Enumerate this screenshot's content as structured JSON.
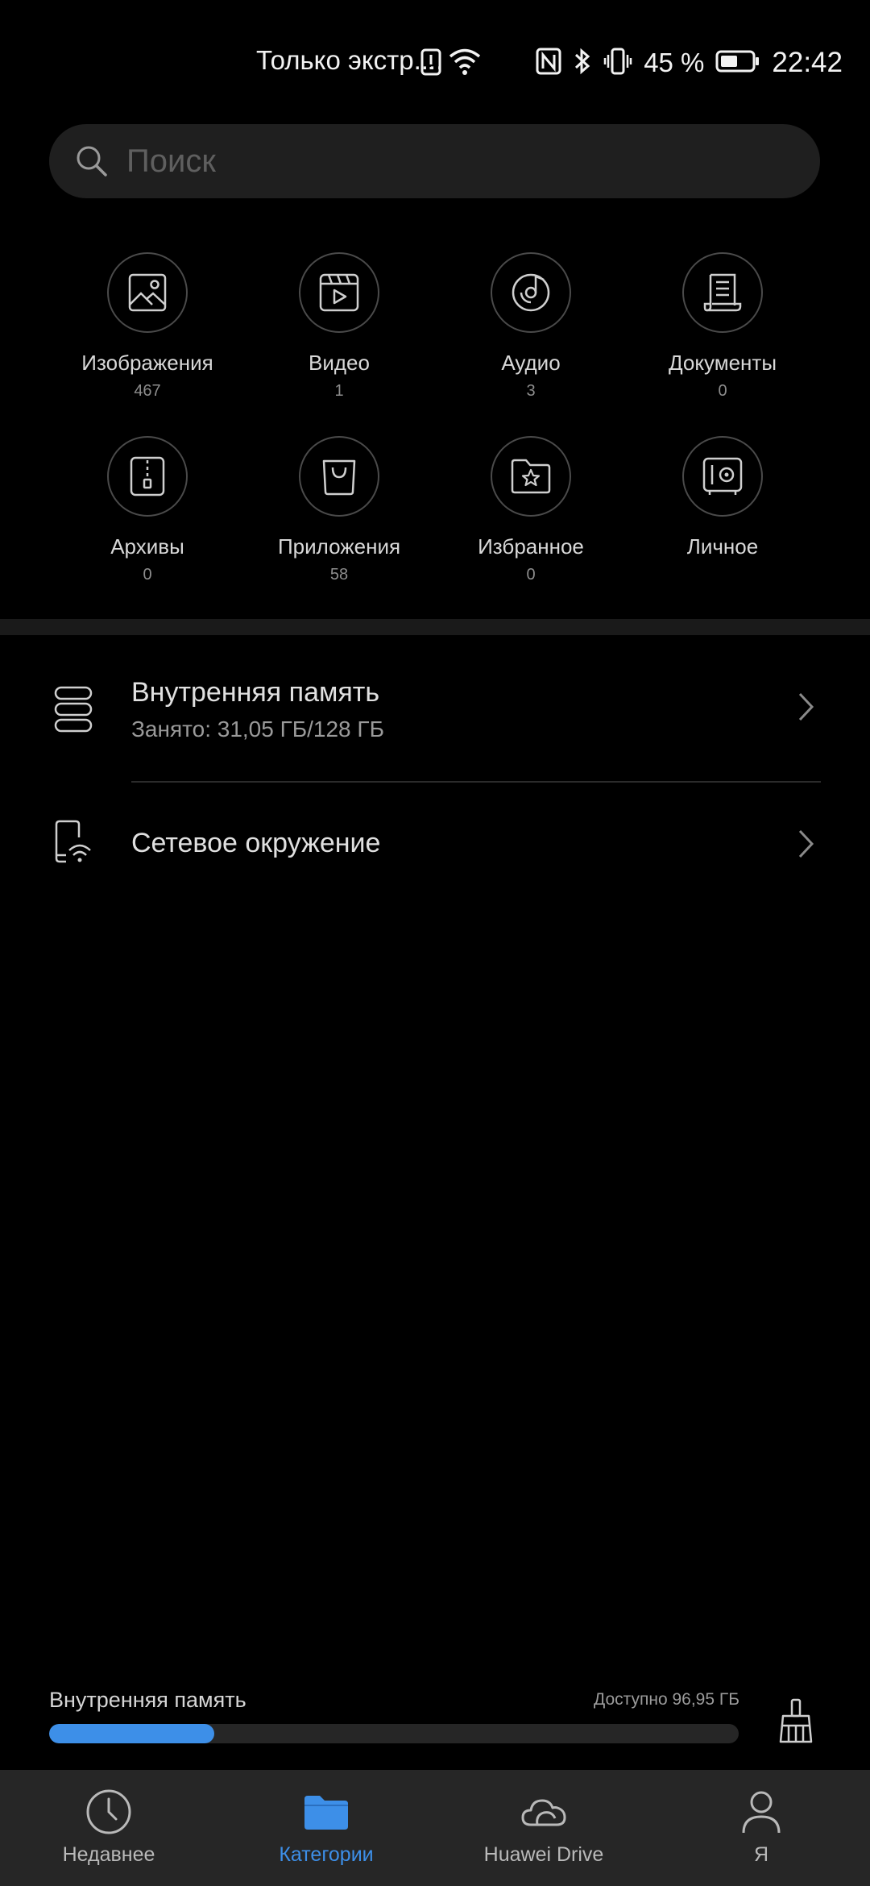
{
  "status_bar": {
    "notice": "Только экстр....",
    "battery_percent": "45 %",
    "time": "22:42"
  },
  "search": {
    "placeholder": "Поиск"
  },
  "categories": [
    {
      "name": "Изображения",
      "count": "467",
      "icon": "image-icon"
    },
    {
      "name": "Видео",
      "count": "1",
      "icon": "video-icon"
    },
    {
      "name": "Аудио",
      "count": "3",
      "icon": "audio-icon"
    },
    {
      "name": "Документы",
      "count": "0",
      "icon": "document-icon"
    },
    {
      "name": "Архивы",
      "count": "0",
      "icon": "archive-icon"
    },
    {
      "name": "Приложения",
      "count": "58",
      "icon": "app-bag-icon"
    },
    {
      "name": "Избранное",
      "count": "0",
      "icon": "favorites-icon"
    },
    {
      "name": "Личное",
      "count": "",
      "icon": "safe-icon"
    }
  ],
  "storage": {
    "internal_title": "Внутренняя память",
    "internal_usage": "Занято: 31,05 ГБ/128 ГБ",
    "network_title": "Сетевое окружение"
  },
  "bottom_memory": {
    "label": "Внутренняя память",
    "available": "Доступно 96,95 ГБ",
    "used_fraction": 0.24
  },
  "tabs": [
    {
      "label": "Недавнее",
      "icon": "clock-icon",
      "active": false
    },
    {
      "label": "Категории",
      "icon": "folder-icon",
      "active": true
    },
    {
      "label": "Huawei Drive",
      "icon": "cloud-icon",
      "active": false
    },
    {
      "label": "Я",
      "icon": "person-icon",
      "active": false
    }
  ],
  "colors": {
    "accent": "#3d8fe8",
    "background": "#000000",
    "tabbar": "#262626"
  }
}
